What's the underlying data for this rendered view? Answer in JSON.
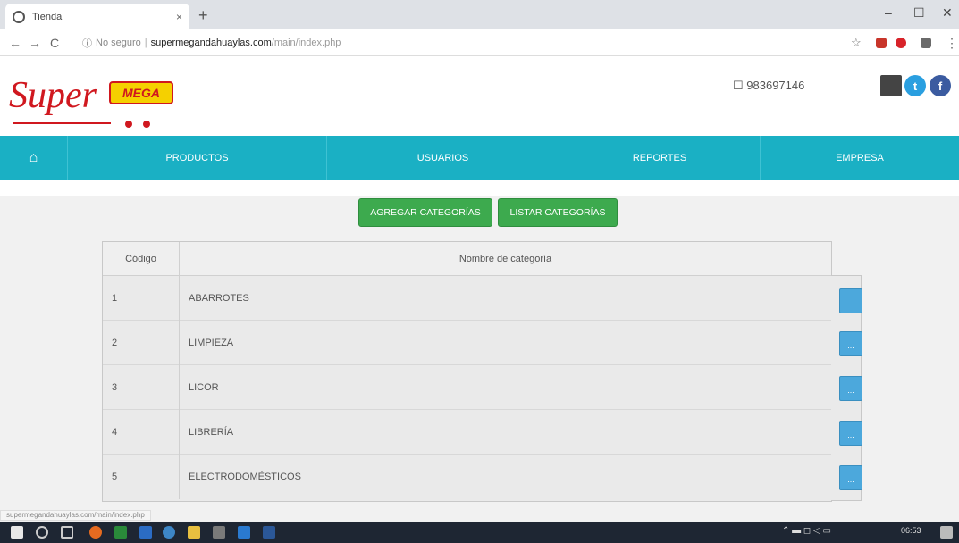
{
  "browser": {
    "tab_title": "Tienda",
    "tab_close": "×",
    "new_tab": "+",
    "min": "–",
    "max": "☐",
    "close": "✕",
    "back": "←",
    "forward": "→",
    "reload": "C",
    "info_icon": "ⓘ",
    "not_secure": "No seguro",
    "sep": "|",
    "url_host": "supermegandahuaylas.com",
    "url_path": "/main/index.php",
    "star": "☆"
  },
  "header": {
    "logo_super": "Super",
    "logo_mega": "MEGA",
    "phone_icon": "☐",
    "phone": "983697146",
    "social_twitter": "t",
    "social_facebook": "f"
  },
  "nav": {
    "home_icon": "⌂",
    "items": [
      "PRODUCTOS",
      "USUARIOS",
      "REPORTES",
      "EMPRESA"
    ]
  },
  "actions": {
    "add": "AGREGAR CATEGORÍAS",
    "list": "LISTAR CATEGORÍAS"
  },
  "table": {
    "headers": {
      "code": "Código",
      "name": "Nombre de categoría"
    },
    "rows": [
      {
        "code": "1",
        "name": "ABARROTES"
      },
      {
        "code": "2",
        "name": "LIMPIEZA"
      },
      {
        "code": "3",
        "name": "LICOR"
      },
      {
        "code": "4",
        "name": "LIBRERÍA"
      },
      {
        "code": "5",
        "name": "ELECTRODOMÉSTICOS"
      }
    ],
    "row_button": "..."
  },
  "status": {
    "url": "supermegandahuaylas.com/main/index.php"
  },
  "taskbar": {
    "time": "06:53"
  },
  "colors": {
    "nav": "#1ab0c4",
    "action_green": "#3daa4e",
    "row_button": "#4ca8dc",
    "logo_red": "#d0181f",
    "logo_yellow": "#f5d000"
  }
}
